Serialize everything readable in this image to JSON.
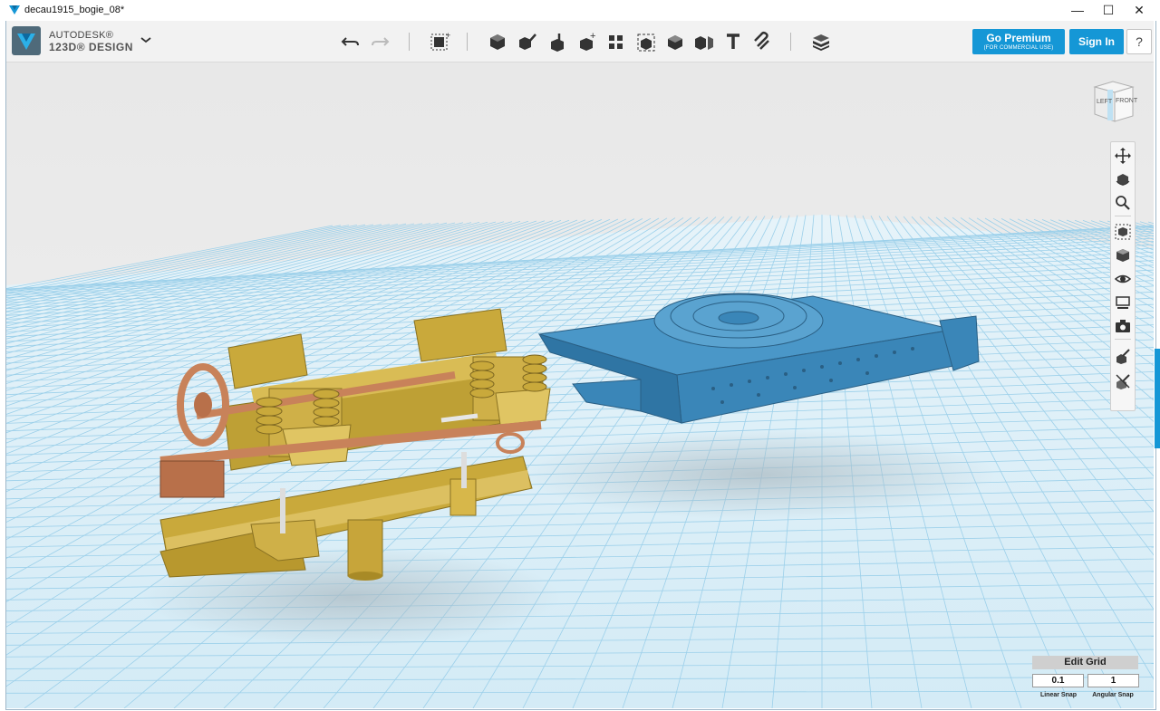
{
  "window": {
    "title": "decau1915_bogie_08*",
    "minimize": "—",
    "maximize": "☐",
    "close": "✕"
  },
  "brand": {
    "line1": "AUTODESK®",
    "line2": "123D® DESIGN",
    "menu_icon": "chevron-down-icon"
  },
  "toolbar": {
    "tools": [
      "undo-icon",
      "redo-icon",
      "transform-icon",
      "primitives-icon",
      "sketch-icon",
      "construct-icon",
      "modify-icon",
      "pattern-icon",
      "group-icon",
      "combine-icon",
      "measure-icon",
      "text-icon",
      "snap-icon",
      "material-icon"
    ]
  },
  "account": {
    "premium_label": "Go Premium",
    "premium_sub": "(FOR COMMERCIAL USE)",
    "signin_label": "Sign In",
    "help_label": "?"
  },
  "viewcube": {
    "left_label": "LEFT",
    "front_label": "FRONT"
  },
  "nav_tools": [
    "pan-icon",
    "orbit-icon",
    "zoom-icon",
    "fit-icon",
    "view-mode-icon",
    "visibility-icon",
    "material-view-icon",
    "camera-icon",
    "snap-edit-icon",
    "snap-off-icon"
  ],
  "grid_panel": {
    "edit_label": "Edit Grid",
    "linear_value": "0.1",
    "angular_value": "1",
    "linear_label": "Linear Snap",
    "angular_label": "Angular Snap"
  },
  "colors": {
    "accent": "#1597d6",
    "grid_line": "#9cd0ea",
    "model_gold": "#c9a93b",
    "model_blue": "#3a86b8",
    "model_copper": "#c8825a"
  }
}
